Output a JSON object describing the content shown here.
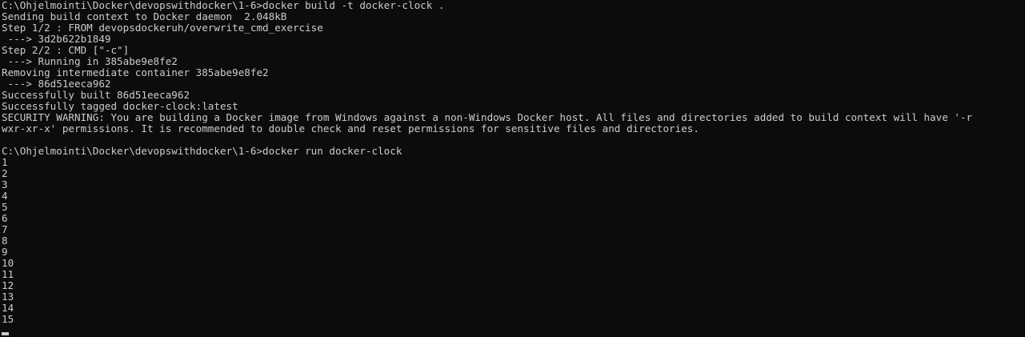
{
  "terminal": {
    "lines": [
      "C:\\Ohjelmointi\\Docker\\devopswithdocker\\1-6>docker build -t docker-clock .",
      "Sending build context to Docker daemon  2.048kB",
      "Step 1/2 : FROM devopsdockeruh/overwrite_cmd_exercise",
      " ---> 3d2b622b1849",
      "Step 2/2 : CMD [\"-c\"]",
      " ---> Running in 385abe9e8fe2",
      "Removing intermediate container 385abe9e8fe2",
      " ---> 86d51eeca962",
      "Successfully built 86d51eeca962",
      "Successfully tagged docker-clock:latest",
      "SECURITY WARNING: You are building a Docker image from Windows against a non-Windows Docker host. All files and directories added to build context will have '-r",
      "wxr-xr-x' permissions. It is recommended to double check and reset permissions for sensitive files and directories.",
      "",
      "C:\\Ohjelmointi\\Docker\\devopswithdocker\\1-6>docker run docker-clock",
      "1",
      "2",
      "3",
      "4",
      "5",
      "6",
      "7",
      "8",
      "9",
      "10",
      "11",
      "12",
      "13",
      "14",
      "15"
    ],
    "colors": {
      "background": "#0c0c0c",
      "text": "#cccccc"
    }
  }
}
